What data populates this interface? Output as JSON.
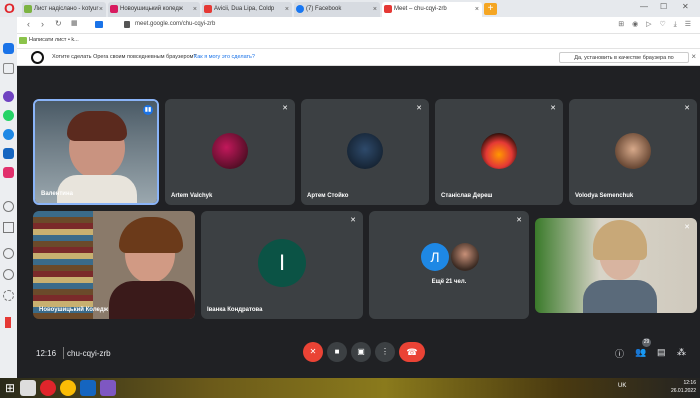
{
  "browser": {
    "tabs": [
      {
        "label": "Лист надіслано - kotyur",
        "color": "#7cb342",
        "active": false
      },
      {
        "label": "Новоушицький коледж",
        "color": "#d81b60",
        "active": false
      },
      {
        "label": "Avicii, Dua Lipa, Coldp",
        "color": "#e53935",
        "active": false
      },
      {
        "label": "(7) Facebook",
        "color": "#1877f2",
        "active": false
      },
      {
        "label": "Meet – chu-cqyi-zrb",
        "color": "#e53935",
        "active": true
      }
    ],
    "url": "meet.google.com/chu-cqyi-zrb",
    "bookmark": "Написати лист • k...",
    "infobar_text": "Хотите сделать Opera своим повседневным браузером?",
    "infobar_link": "Как я могу это сделать?",
    "infobar_button": "Да, установить в качестве браузера по умолчанию"
  },
  "meet": {
    "tiles": [
      {
        "name": "Валентина",
        "kind": "video"
      },
      {
        "name": "Artem Valchyk",
        "kind": "avatar"
      },
      {
        "name": "Артем Стойко",
        "kind": "avatar"
      },
      {
        "name": "Станіслав Дереш",
        "kind": "avatar"
      },
      {
        "name": "Volodya Semenchuk",
        "kind": "avatar"
      },
      {
        "name": "Новоушицький Коледж",
        "kind": "video"
      },
      {
        "name": "Іванка Кондратова",
        "kind": "letter",
        "letter": "І"
      },
      {
        "name": "Ещё 21 чел.",
        "kind": "group",
        "letter": "Л"
      },
      {
        "name": "",
        "kind": "video"
      }
    ],
    "time": "12:16",
    "code": "chu-cqyi-zrb",
    "participants_count": "29"
  },
  "taskbar": {
    "lang": "UK",
    "time": "12:16",
    "date": "26.01.2022"
  },
  "colors": {
    "accent": "#1a73e8",
    "end_call": "#ea4335",
    "meet_bg": "#202124",
    "tile_bg": "#3c4043"
  }
}
